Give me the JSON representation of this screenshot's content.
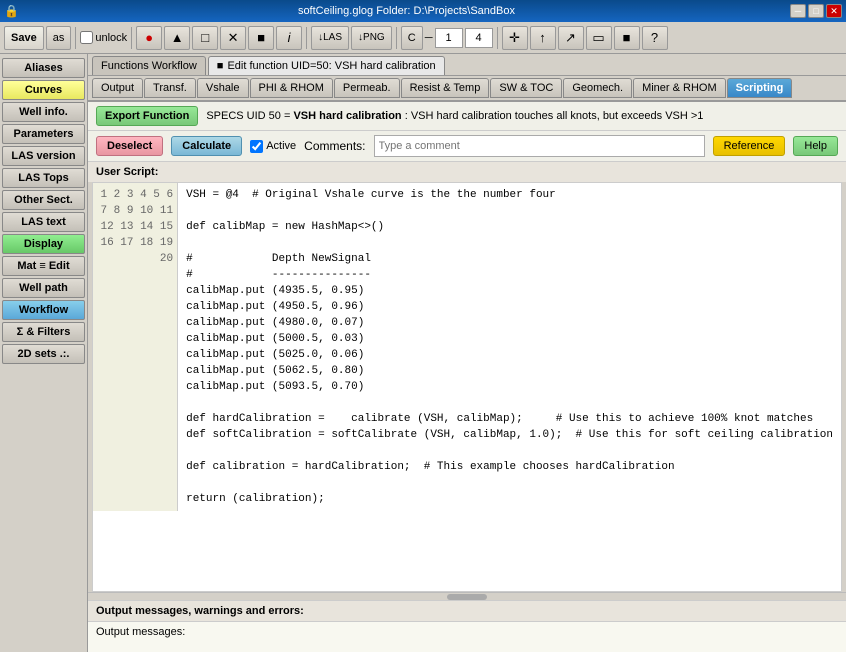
{
  "titlebar": {
    "title": "softCeiling.glog    Folder: D:\\Projects\\SandBox",
    "lock_icon": "🔒",
    "minimize": "─",
    "restore": "□",
    "close": "✕"
  },
  "toolbar": {
    "save_label": "Save",
    "as_label": "as",
    "unlock_label": "unlock",
    "undo_icon": "◄",
    "redo_icon": "►",
    "triangle_icon": "▲",
    "x_icon": "✕",
    "square_icon": "□",
    "italic_icon": "i",
    "las_label": "↓LAS",
    "png_label": "↓PNG",
    "c_label": "C",
    "minus_label": "─ 1",
    "plus_label": "4",
    "crosshair_icon": "✛",
    "arrow_icon": "↑",
    "curve_icon": "↗",
    "rect_icon": "□",
    "stop_icon": "■",
    "help_icon": "?"
  },
  "tabs": {
    "functions_workflow": "Functions Workflow",
    "edit_tab": "Edit function UID=50: VSH hard calibration",
    "edit_square": "■"
  },
  "subtabs": [
    "Output",
    "Transf.",
    "Vshale",
    "PHI & RHOM",
    "Permeab.",
    "Resist & Temp",
    "SW & TOC",
    "Geomech.",
    "Miner & RHOM",
    "Scripting"
  ],
  "func_info": {
    "export_btn": "Export Function",
    "specs_text": "SPECS UID 50 =",
    "bold_name": "VSH hard calibration",
    "colon": " : VSH hard calibration touches all knots, but exceeds VSH >1"
  },
  "action_bar": {
    "deselect_btn": "Deselect",
    "calculate_btn": "Calculate",
    "active_label": "Active",
    "comments_label": "Comments:",
    "comments_placeholder": "Type a comment",
    "reference_btn": "Reference",
    "help_btn": "Help"
  },
  "script": {
    "label": "User Script:",
    "lines": [
      "VSH = @4  # Original Vshale curve is the the number four",
      "",
      "def calibMap = new HashMap<>()",
      "",
      "#            Depth NewSignal",
      "#            ---------------",
      "calibMap.put (4935.5, 0.95)",
      "calibMap.put (4950.5, 0.96)",
      "calibMap.put (4980.0, 0.07)",
      "calibMap.put (5000.5, 0.03)",
      "calibMap.put (5025.0, 0.06)",
      "calibMap.put (5062.5, 0.80)",
      "calibMap.put (5093.5, 0.70)",
      "",
      "def hardCalibration =    calibrate (VSH, calibMap);     # Use this to achieve 100% knot matches",
      "def softCalibration = softCalibrate (VSH, calibMap, 1.0);  # Use this for soft ceiling calibration",
      "",
      "def calibration = hardCalibration;  # This example chooses hardCalibration",
      "",
      "return (calibration);"
    ]
  },
  "output": {
    "label": "Output messages, warnings and errors:",
    "content": "Output messages:"
  },
  "sidebar": {
    "items": [
      {
        "label": "Aliases",
        "style": "normal"
      },
      {
        "label": "Curves",
        "style": "yellow"
      },
      {
        "label": "Well info.",
        "style": "normal"
      },
      {
        "label": "Parameters",
        "style": "normal"
      },
      {
        "label": "LAS version",
        "style": "normal"
      },
      {
        "label": "LAS Tops",
        "style": "normal"
      },
      {
        "label": "Other Sect.",
        "style": "normal"
      },
      {
        "label": "LAS text",
        "style": "normal"
      },
      {
        "label": "Display",
        "style": "green"
      },
      {
        "label": "Mat ≡ Edit",
        "style": "normal"
      },
      {
        "label": "Well path",
        "style": "normal"
      },
      {
        "label": "Workflow",
        "style": "active"
      },
      {
        "label": "Σ & Filters",
        "style": "normal"
      },
      {
        "label": "2D sets .:.",
        "style": "normal"
      }
    ]
  }
}
